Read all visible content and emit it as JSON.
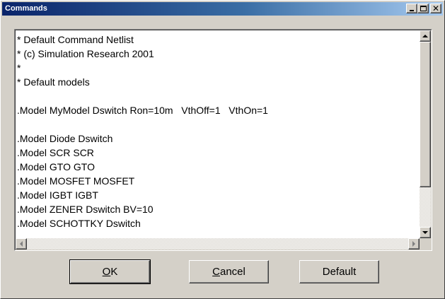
{
  "window": {
    "title": "Commands",
    "minimize_glyph": "",
    "maximize_glyph": "",
    "close_glyph": "✕"
  },
  "editor": {
    "lines": [
      "* Default Command Netlist",
      "* (c) Simulation Research 2001",
      "*",
      "* Default models",
      "",
      ".Model MyModel Dswitch Ron=10m   VthOff=1   VthOn=1",
      "",
      ".Model Diode Dswitch",
      ".Model SCR SCR",
      ".Model GTO GTO",
      ".Model MOSFET MOSFET",
      ".Model IGBT IGBT",
      ".Model ZENER Dswitch BV=10",
      ".Model SCHOTTKY Dswitch"
    ]
  },
  "buttons": {
    "ok_accel": "O",
    "ok_rest": "K",
    "cancel_accel": "C",
    "cancel_rest": "ancel",
    "default_label": "Default"
  },
  "colors": {
    "title_gradient_start": "#0a246a",
    "title_gradient_end": "#a6caf0",
    "face": "#d4d0c8"
  }
}
